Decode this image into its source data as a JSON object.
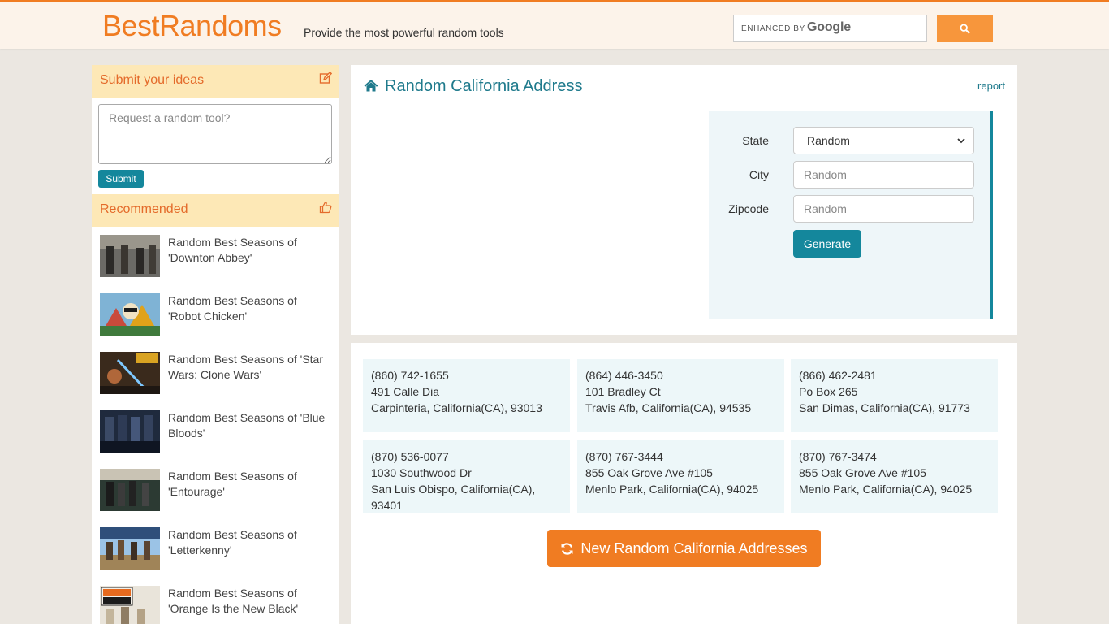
{
  "header": {
    "logo": "BestRandoms",
    "tagline": "Provide the most powerful random tools",
    "search": {
      "enhanced_label": "ENHANCED BY",
      "brand": "Google"
    },
    "accent_color": "#f07c22"
  },
  "sidebar": {
    "ideas_title": "Submit your ideas",
    "ideas_placeholder": "Request a random tool?",
    "submit_label": "Submit",
    "recommended_title": "Recommended",
    "items": [
      {
        "label": "Random Best Seasons of 'Downton Abbey'"
      },
      {
        "label": "Random Best Seasons of 'Robot Chicken'"
      },
      {
        "label": "Random Best Seasons of 'Star Wars: Clone Wars'"
      },
      {
        "label": "Random Best Seasons of 'Blue Bloods'"
      },
      {
        "label": "Random Best Seasons of 'Entourage'"
      },
      {
        "label": "Random Best Seasons of 'Letterkenny'"
      },
      {
        "label": "Random Best Seasons of 'Orange Is the New Black'"
      }
    ]
  },
  "main": {
    "title": "Random California Address",
    "report_label": "report",
    "form": {
      "state_label": "State",
      "state_value": "Random",
      "city_label": "City",
      "city_placeholder": "Random",
      "zip_label": "Zipcode",
      "zip_placeholder": "Random",
      "generate_label": "Generate"
    },
    "results": [
      {
        "phone": "(860) 742-1655",
        "street": "491 Calle Dia",
        "city_line": "Carpinteria, California(CA), 93013"
      },
      {
        "phone": "(864) 446-3450",
        "street": "101 Bradley Ct",
        "city_line": "Travis Afb, California(CA), 94535"
      },
      {
        "phone": "(866) 462-2481",
        "street": "Po Box 265",
        "city_line": "San Dimas, California(CA), 91773"
      },
      {
        "phone": "(870) 536-0077",
        "street": "1030 Southwood Dr",
        "city_line": "San Luis Obispo, California(CA), 93401"
      },
      {
        "phone": "(870) 767-3444",
        "street": "855 Oak Grove Ave #105",
        "city_line": "Menlo Park, California(CA), 94025"
      },
      {
        "phone": "(870) 767-3474",
        "street": "855 Oak Grove Ave #105",
        "city_line": "Menlo Park, California(CA), 94025"
      }
    ],
    "new_button_label": "New Random California Addresses"
  }
}
